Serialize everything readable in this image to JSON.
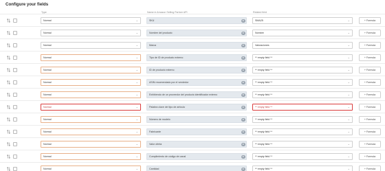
{
  "title": "Configure your fields",
  "headers": {
    "type": "Type",
    "name": "Name in Amazon Selling Partner API",
    "related": "Related field"
  },
  "icons": {
    "drag": "drag-handle-icon",
    "chevron": "chevron-down-icon",
    "gear": "gear-icon",
    "plus": "plus-icon"
  },
  "formula_label": "+ Formula",
  "rows": [
    {
      "type": "Normal",
      "name": "SKU",
      "related": "SMA25"
    },
    {
      "type": "Normal",
      "name": "Nombre del producto",
      "related": "Nombre"
    },
    {
      "type": "Normal",
      "name": "Marca",
      "related": "Valoraciones"
    },
    {
      "type": "Normal",
      "name": "Tipo de ID de producto externo",
      "related": "** empty field **"
    },
    {
      "type": "Normal",
      "name": "ID de producto externo",
      "related": "** empty field **"
    },
    {
      "type": "Normal",
      "name": "ASIN recomendado por el vendedor",
      "related": "** empty field **"
    },
    {
      "type": "Normal",
      "name": "Exhibiendo de un proveedor del producto identificador externo",
      "related": "** empty field **"
    },
    {
      "type": "Normal",
      "name": "Palabra clave del tipo de artículo",
      "related": "** empty field **"
    },
    {
      "type": "Normal",
      "name": "Número de modelo",
      "related": "** empty field **"
    },
    {
      "type": "Normal",
      "name": "Fabricante",
      "related": "** empty field **"
    },
    {
      "type": "Normal",
      "name": "Valor oferta",
      "related": "** empty field **"
    },
    {
      "type": "Normal",
      "name": "Cumplimiento de código de canal",
      "related": "** empty field **"
    },
    {
      "type": "Normal",
      "name": "Cantidad",
      "related": "** empty field **"
    }
  ]
}
